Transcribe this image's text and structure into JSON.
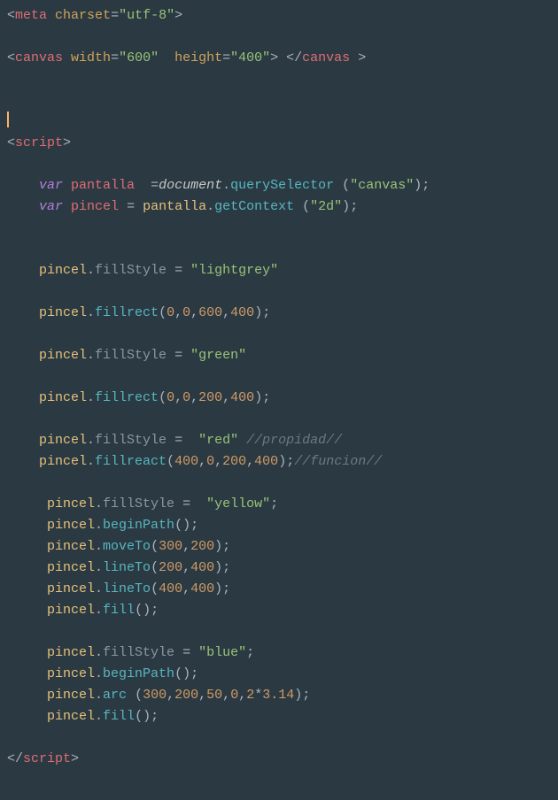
{
  "lines": {
    "l1_open": "<",
    "l1_tag": "meta",
    "l1_sp": " ",
    "l1_attr": "charset",
    "l1_eq": "=",
    "l1_str": "\"utf-8\"",
    "l1_close": ">",
    "l3_open": "<",
    "l3_tag": "canvas",
    "l3_sp": " ",
    "l3_attr1": "width",
    "l3_eq": "=",
    "l3_str1": "\"600\"",
    "l3_sp2": "  ",
    "l3_attr2": "height",
    "l3_str2": "\"400\"",
    "l3_mid": "> </",
    "l3_tag2": "canvas",
    "l3_end": " >",
    "script_open_lt": "<",
    "script_tag": "script",
    "script_open_gt": ">",
    "v1_ind": "    ",
    "v1_kw": "var",
    "v1_sp": " ",
    "v1_name": "pantalla",
    "v1_sp2": "  ",
    "v1_eq": "=",
    "v1_doc": "document",
    "v1_dot": ".",
    "v1_fn": "querySelector",
    "v1_sp3": " ",
    "v1_paren": "(",
    "v1_str": "\"canvas\"",
    "v1_paren2": ")",
    "v1_semi": ";",
    "v2_kw": "var",
    "v2_name": "pincel",
    "v2_eq": " = ",
    "v2_obj": "pantalla",
    "v2_dot": ".",
    "v2_fn": "getContext",
    "v2_sp": " ",
    "v2_paren": "(",
    "v2_str": "\"2d\"",
    "v2_paren2": ")",
    "v2_semi": ";",
    "fs_obj": "pincel",
    "fs_dot": ".",
    "fs_prop": "fillStyle",
    "fs_eq": " = ",
    "fs_str1": "\"lightgrey\"",
    "fr_fn": "fillrect",
    "fr_paren": "(",
    "fr_a0": "0",
    "fr_c": ",",
    "fr_a1": "0",
    "fr_a2": "600",
    "fr_a3": "400",
    "fr_paren2": ")",
    "fr_semi": ";",
    "fs_str2": "\"green\"",
    "fr2_a2": "200",
    "fr2_a3": "400",
    "fs_eq2": " =  ",
    "fs_str3": "\"red\"",
    "cmt1": " //propidad//",
    "freact_fn": "fillreact",
    "freact_a0": "400",
    "freact_a1": "0",
    "freact_a2": "200",
    "freact_a3": "400",
    "cmt2": "//funcion//",
    "fs_str4": "\"yellow\"",
    "fs_semi": ";",
    "bp_fn": "beginPath",
    "bp_pp": "();",
    "mt_fn": "moveTo",
    "mt_a0": "300",
    "mt_a1": "200",
    "lt_fn": "lineTo",
    "lt1_a0": "200",
    "lt1_a1": "400",
    "lt2_a0": "400",
    "lt2_a1": "400",
    "fill_fn": "fill",
    "fs_str5": "\"blue\"",
    "arc_fn": "arc",
    "arc_sp": " ",
    "arc_a0": "300",
    "arc_a1": "200",
    "arc_a2": "50",
    "arc_a3": "0",
    "arc_a4a": "2",
    "arc_star": "*",
    "arc_a4b": "3.14",
    "script_close_lt": "</",
    "script_close_gt": ">"
  }
}
